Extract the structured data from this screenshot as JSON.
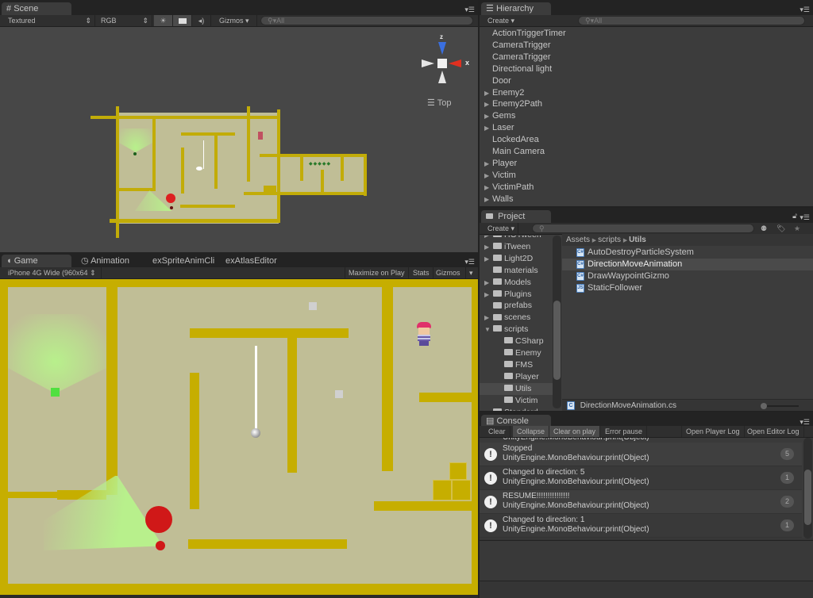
{
  "scene": {
    "tab_label": "Scene",
    "render_mode": "Textured",
    "color_mode": "RGB",
    "gizmos_label": "Gizmos",
    "search_placeholder": "All",
    "view_label": "Top",
    "axis_z": "z",
    "axis_x": "x",
    "icons": {
      "lighting": "sun-icon",
      "image_effects": "image-icon",
      "audio": "speaker-icon"
    }
  },
  "game": {
    "tabs": [
      {
        "label": "Game",
        "icon": "pacman-icon"
      },
      {
        "label": "Animation",
        "icon": "clock-icon"
      },
      {
        "label": "exSpriteAnimCli"
      },
      {
        "label": "exAtlasEditor"
      }
    ],
    "aspect": "iPhone 4G Wide (960x64",
    "maximize_label": "Maximize on Play",
    "stats_label": "Stats",
    "gizmos_label": "Gizmos"
  },
  "hierarchy": {
    "tab_label": "Hierarchy",
    "create_label": "Create",
    "search_placeholder": "All",
    "items": [
      {
        "label": "ActionTriggerTimer",
        "expandable": false
      },
      {
        "label": "CameraTrigger",
        "expandable": false
      },
      {
        "label": "CameraTrigger",
        "expandable": false
      },
      {
        "label": "Directional light",
        "expandable": false
      },
      {
        "label": "Door",
        "expandable": false
      },
      {
        "label": "Enemy2",
        "expandable": true
      },
      {
        "label": "Enemy2Path",
        "expandable": true
      },
      {
        "label": "Gems",
        "expandable": true
      },
      {
        "label": "Laser",
        "expandable": true
      },
      {
        "label": "LockedArea",
        "expandable": false
      },
      {
        "label": "Main Camera",
        "expandable": false
      },
      {
        "label": "Player",
        "expandable": true
      },
      {
        "label": "Victim",
        "expandable": true
      },
      {
        "label": "VictimPath",
        "expandable": true
      },
      {
        "label": "Walls",
        "expandable": true
      }
    ]
  },
  "project": {
    "tab_label": "Project",
    "create_label": "Create",
    "breadcrumb": [
      "Assets",
      "scripts",
      "Utils"
    ],
    "tree": [
      {
        "label": "HOTween",
        "level": 0,
        "arrow": "right"
      },
      {
        "label": "iTween",
        "level": 0,
        "arrow": "right"
      },
      {
        "label": "Light2D",
        "level": 0,
        "arrow": "right"
      },
      {
        "label": "materials",
        "level": 0,
        "arrow": ""
      },
      {
        "label": "Models",
        "level": 0,
        "arrow": "right"
      },
      {
        "label": "Plugins",
        "level": 0,
        "arrow": "right"
      },
      {
        "label": "prefabs",
        "level": 0,
        "arrow": ""
      },
      {
        "label": "scenes",
        "level": 0,
        "arrow": "right"
      },
      {
        "label": "scripts",
        "level": 0,
        "arrow": "down"
      },
      {
        "label": "CSharp",
        "level": 1,
        "arrow": ""
      },
      {
        "label": "Enemy",
        "level": 1,
        "arrow": ""
      },
      {
        "label": "FMS",
        "level": 1,
        "arrow": ""
      },
      {
        "label": "Player",
        "level": 1,
        "arrow": ""
      },
      {
        "label": "Utils",
        "level": 1,
        "arrow": "",
        "selected": true
      },
      {
        "label": "Victim",
        "level": 1,
        "arrow": ""
      },
      {
        "label": "Standard",
        "level": 0,
        "arrow": "right"
      }
    ],
    "files": [
      {
        "label": "AutoDestroyParticleSystem",
        "type": "C#"
      },
      {
        "label": "DirectionMoveAnimation",
        "type": "C#",
        "selected": true
      },
      {
        "label": "DrawWaypointGizmo",
        "type": "C#"
      },
      {
        "label": "StaticFollower",
        "type": "JS"
      }
    ],
    "selected_file": "DirectionMoveAnimation.cs"
  },
  "console": {
    "tab_label": "Console",
    "buttons": [
      {
        "label": "Clear",
        "active": false
      },
      {
        "label": "Collapse",
        "active": true
      },
      {
        "label": "Clear on play",
        "active": true
      },
      {
        "label": "Error pause",
        "active": false
      }
    ],
    "right_buttons": [
      "Open Player Log",
      "Open Editor Log"
    ],
    "partial_top": "UnityEngine.MonoBehaviour:print(Object)",
    "entries": [
      {
        "message": "Stopped",
        "source": "UnityEngine.MonoBehaviour:print(Object)",
        "count": "5"
      },
      {
        "message": "Changed to direction: 5",
        "source": "UnityEngine.MonoBehaviour:print(Object)",
        "count": "1"
      },
      {
        "message": "RESUME!!!!!!!!!!!!!!!",
        "source": "UnityEngine.MonoBehaviour:print(Object)",
        "count": "2"
      },
      {
        "message": "Changed to direction: 1",
        "source": "UnityEngine.MonoBehaviour:print(Object)",
        "count": "1"
      }
    ]
  },
  "colors": {
    "wall": "#c6ae00",
    "floor": "#c0be96",
    "enemy": "#d01818",
    "vision": "#b8f08c"
  }
}
